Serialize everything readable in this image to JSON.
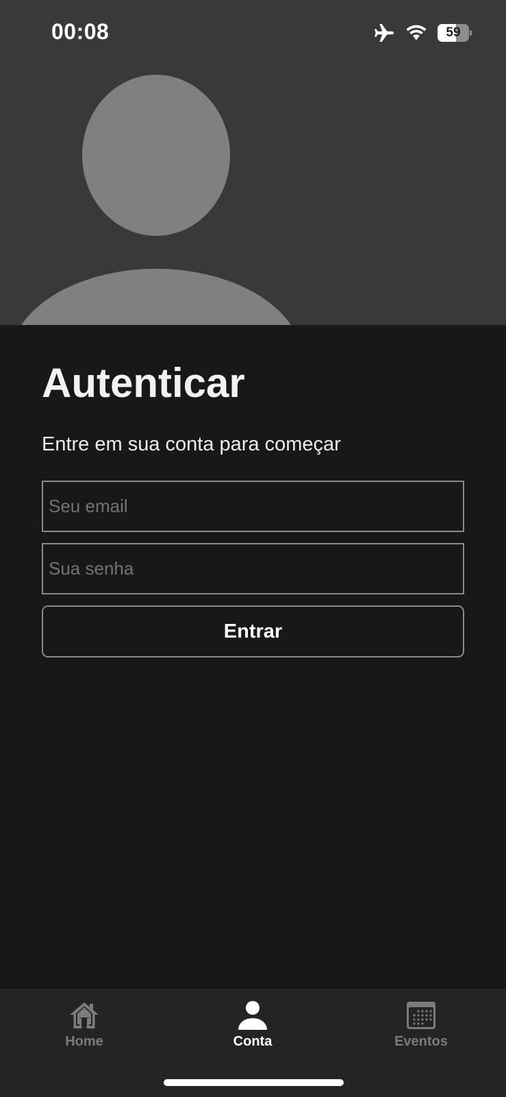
{
  "status_bar": {
    "time": "00:08",
    "battery_level": "59",
    "battery_fraction": 0.59
  },
  "auth": {
    "title": "Autenticar",
    "subtitle": "Entre em sua conta para começar",
    "email_placeholder": "Seu email",
    "password_placeholder": "Sua senha",
    "submit_label": "Entrar"
  },
  "tabs": [
    {
      "label": "Home",
      "icon": "house-icon",
      "active": false
    },
    {
      "label": "Conta",
      "icon": "person-icon",
      "active": true
    },
    {
      "label": "Eventos",
      "icon": "calendar-icon",
      "active": false
    }
  ],
  "colors": {
    "background": "#17181a",
    "header_background": "#383939",
    "avatar_placeholder": "#808080",
    "tab_active": "#ffffff",
    "tab_inactive": "#7b7b7b"
  }
}
